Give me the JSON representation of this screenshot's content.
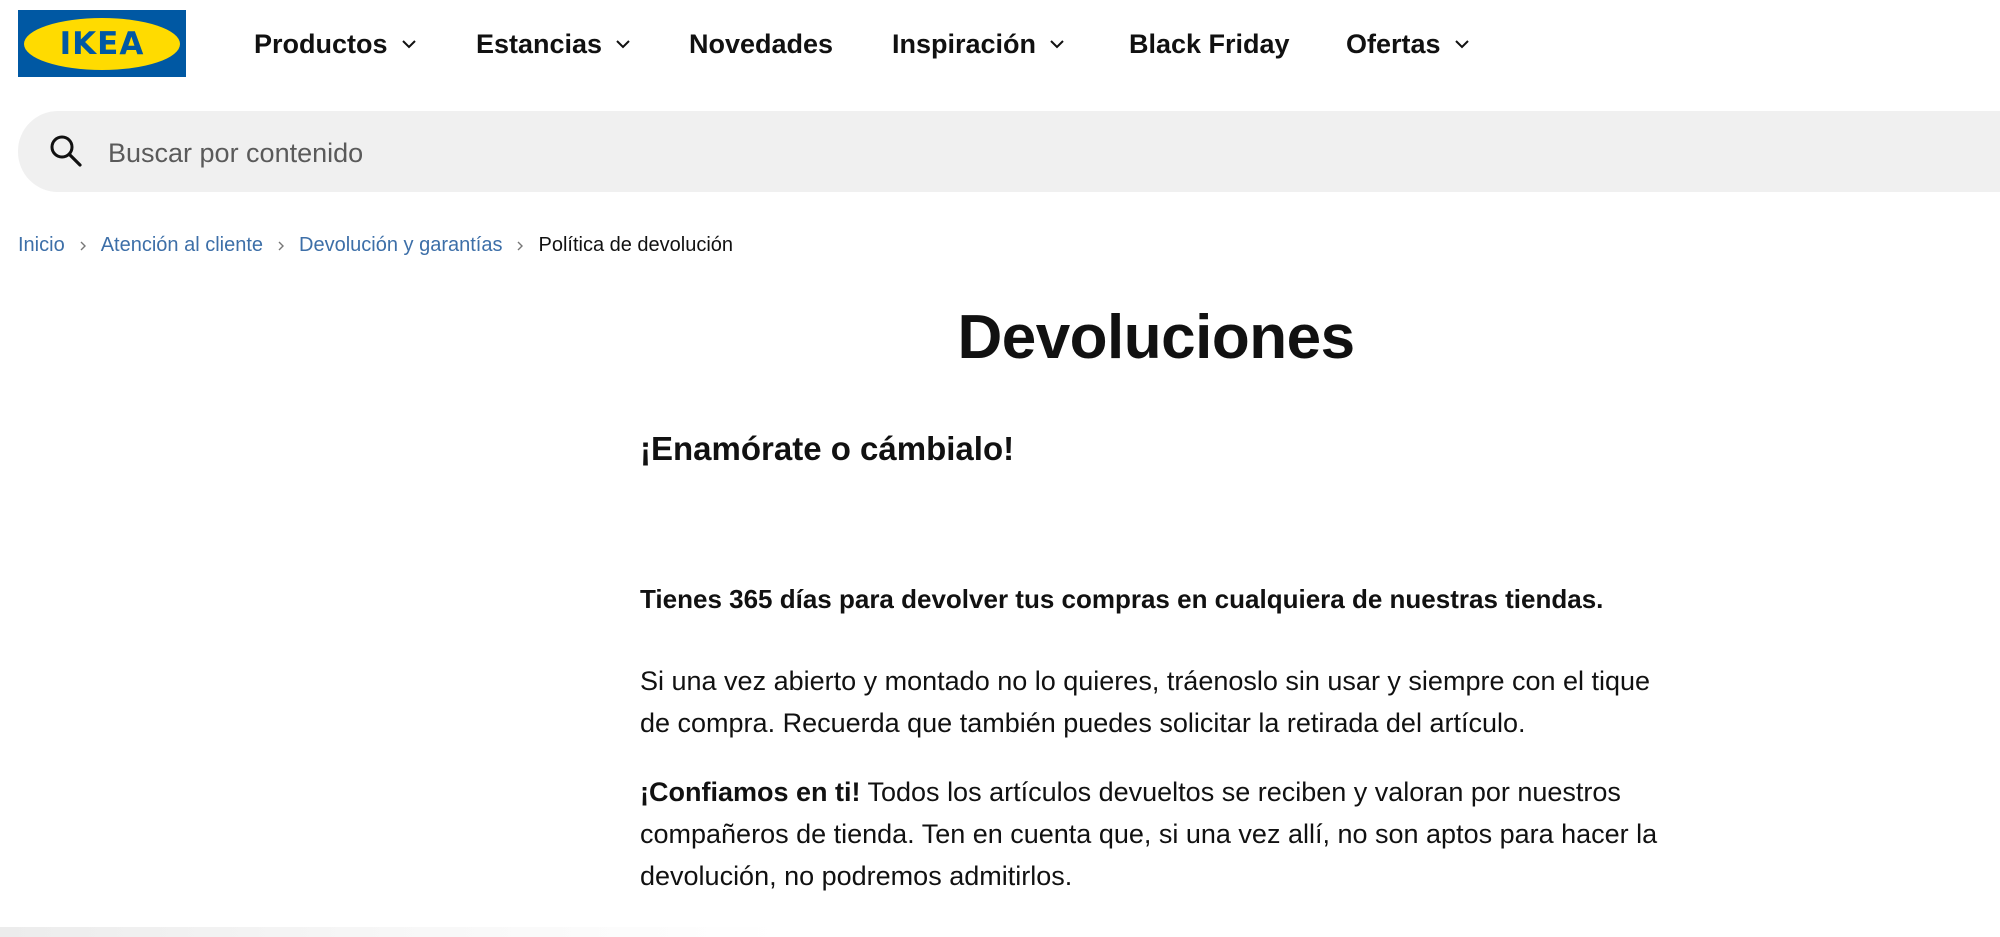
{
  "brand": {
    "logo_text": "IKEA",
    "colors": {
      "blue": "#0058a3",
      "yellow": "#ffdb00",
      "link": "#3d6fa8"
    }
  },
  "nav": {
    "items": [
      {
        "label": "Productos",
        "has_dropdown": true
      },
      {
        "label": "Estancias",
        "has_dropdown": true
      },
      {
        "label": "Novedades",
        "has_dropdown": false
      },
      {
        "label": "Inspiración",
        "has_dropdown": true
      },
      {
        "label": "Black Friday",
        "has_dropdown": false
      },
      {
        "label": "Ofertas",
        "has_dropdown": true
      }
    ]
  },
  "search": {
    "placeholder": "Buscar por contenido",
    "value": "",
    "icon": "search-icon"
  },
  "breadcrumb": {
    "items": [
      {
        "label": "Inicio"
      },
      {
        "label": "Atención al cliente"
      },
      {
        "label": "Devolución y garantías"
      },
      {
        "label": "Política de devolución"
      }
    ]
  },
  "main": {
    "title": "Devoluciones",
    "subtitle": "¡Enamórate o cámbialo!",
    "lead": "Tienes 365 días para devolver tus compras en cualquiera de nuestras tiendas.",
    "paragraph1": "Si una vez abierto y montado no lo quieres, tráenoslo sin usar y siempre con el tique de compra. Recuerda que también puedes solicitar la retirada del artículo.",
    "paragraph2_bold": "¡Confiamos en ti!",
    "paragraph2_text": " Todos los artículos devueltos se reciben y valoran por nuestros compañeros de tienda. Ten en cuenta que, si una vez allí, no son aptos para hacer la devolución, no podremos admitirlos."
  }
}
